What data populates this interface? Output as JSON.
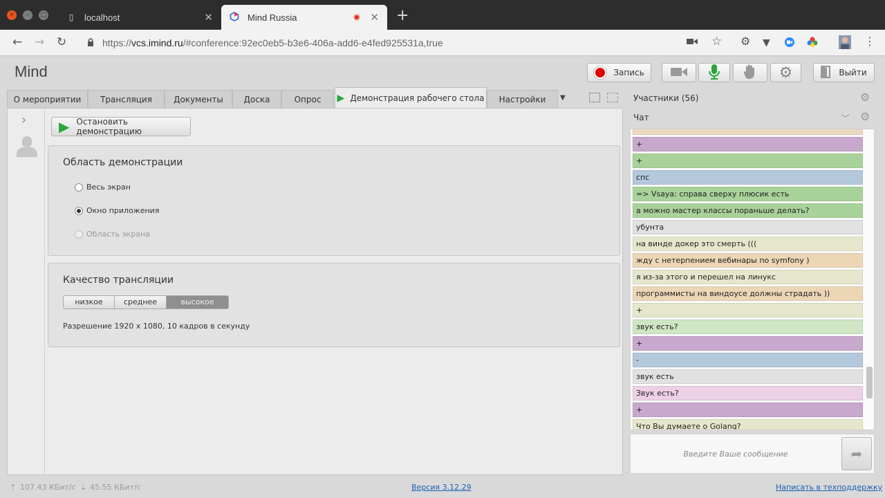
{
  "browser": {
    "tabs": [
      {
        "title": "localhost",
        "active": false
      },
      {
        "title": "Mind Russia",
        "active": true
      }
    ],
    "new_tab": "+",
    "url": {
      "scheme": "https://",
      "host": "vcs.imind.ru",
      "rest": "/#conference:92ec0eb5-b3e6-406a-add6-e4fed925531a,true"
    }
  },
  "app": {
    "logo": "Mind",
    "record_label": "Запись",
    "exit_label": "Выйти",
    "tabs": [
      {
        "label": "О мероприятии"
      },
      {
        "label": "Трансляция"
      },
      {
        "label": "Документы"
      },
      {
        "label": "Доска"
      },
      {
        "label": "Опрос"
      },
      {
        "label": "Демонстрация рабочего стола",
        "active": true
      },
      {
        "label": "Настройки"
      }
    ]
  },
  "demo": {
    "stop_label": "Остановить демонстрацию",
    "area": {
      "title": "Область демонстрации",
      "options": [
        {
          "label": "Весь экран",
          "checked": false,
          "disabled": false
        },
        {
          "label": "Окно приложения",
          "checked": true,
          "disabled": false
        },
        {
          "label": "Область экрана",
          "checked": false,
          "disabled": true
        }
      ]
    },
    "quality": {
      "title": "Качество трансляции",
      "levels": [
        "низкое",
        "среднее",
        "высокое"
      ],
      "selected": "высокое",
      "resolution": "Разрешение 1920 x 1080, 10 кадров в секунду"
    }
  },
  "sidebar": {
    "participants_label": "Участники (56)",
    "chat_label": "Чат",
    "messages": [
      {
        "text": "",
        "color": "#ead8c0"
      },
      {
        "text": "+",
        "color": "#c8a8cc"
      },
      {
        "text": "+",
        "color": "#a9d29a"
      },
      {
        "text": "спс",
        "color": "#b4c8dc"
      },
      {
        "text": "=> Vsaya: справа сверху плюсик есть",
        "color": "#a9d29a"
      },
      {
        "text": "а можно мастер классы пораньше делать?",
        "color": "#a9d29a"
      },
      {
        "text": "убунта",
        "color": "#e1e1e1"
      },
      {
        "text": "на винде докер это смерть (((",
        "color": "#e6e6cc"
      },
      {
        "text": "жду с нетерпением вебинары по symfony )",
        "color": "#ecd6b6"
      },
      {
        "text": "я из-за этого и перешел на линукс",
        "color": "#e6e6cc"
      },
      {
        "text": "программисты на виндоусе должны страдать ))",
        "color": "#ecd6b6"
      },
      {
        "text": "+",
        "color": "#e6e6cc"
      },
      {
        "text": "звук есть?",
        "color": "#cfe6c4"
      },
      {
        "text": "+",
        "color": "#c8a8cc"
      },
      {
        "text": "-",
        "color": "#b4c8dc"
      },
      {
        "text": "звук есть",
        "color": "#e1e1e1"
      },
      {
        "text": "Звук есть?",
        "color": "#ecd0e6"
      },
      {
        "text": "+",
        "color": "#c8a8cc"
      },
      {
        "text": "Что Вы думаете о Golang?",
        "color": "#e6e6cc"
      }
    ],
    "scroll_position": 0.88,
    "input_placeholder": "Введите Ваше сообщение"
  },
  "footer": {
    "upload": "107.43 КБит/с",
    "download": "45.55 КБит/с",
    "version": "Версия 3.12.29",
    "support": "Написать в техподдержку"
  }
}
